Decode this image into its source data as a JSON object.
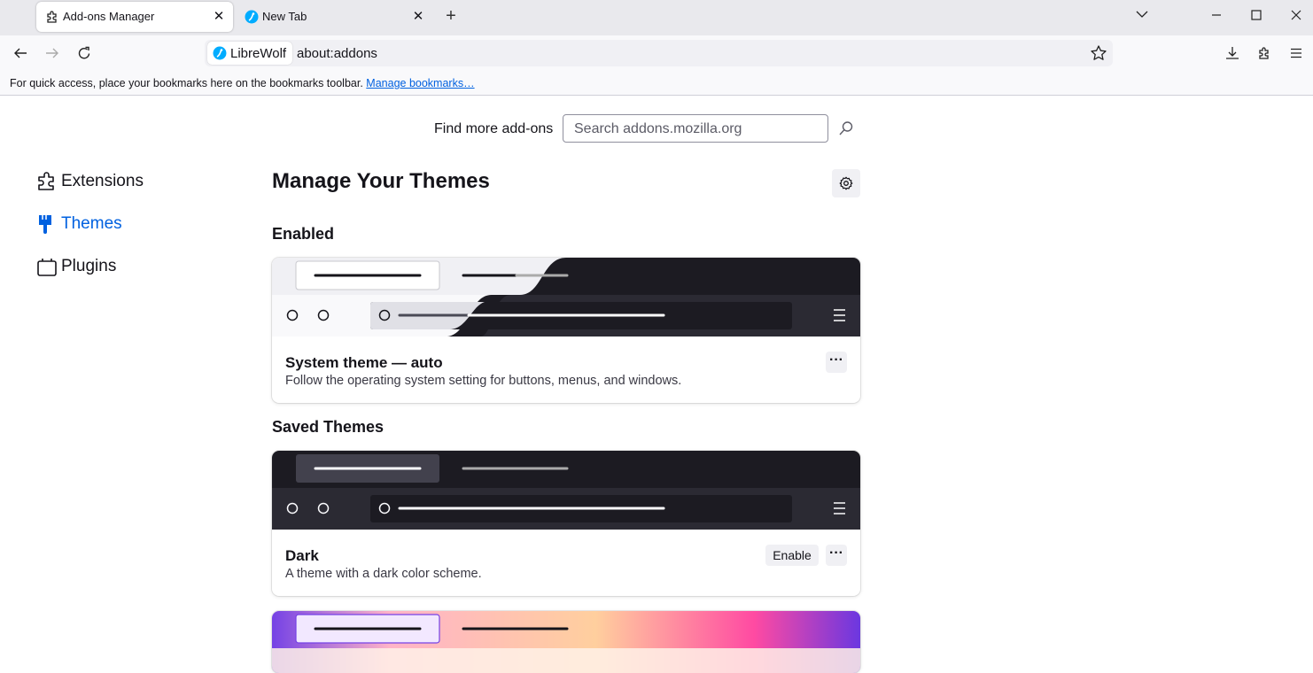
{
  "browser": {
    "tabs": [
      {
        "label": "Add-ons Manager",
        "active": true,
        "icon": "puzzle-icon"
      },
      {
        "label": "New Tab",
        "active": false,
        "icon": "librewolf-icon"
      }
    ],
    "new_tab_symbol": "+",
    "close_symbol": "✕",
    "urlbar": {
      "identity_label": "LibreWolf",
      "url": "about:addons"
    },
    "bookmarks_toolbar": {
      "message": "For quick access, place your bookmarks here on the bookmarks toolbar.",
      "link": "Manage bookmarks…"
    }
  },
  "addons": {
    "find_more_label": "Find more add-ons",
    "search_placeholder": "Search addons.mozilla.org",
    "categories": [
      {
        "label": "Extensions",
        "icon": "puzzle-icon",
        "selected": false
      },
      {
        "label": "Themes",
        "icon": "paintbrush-icon",
        "selected": true
      },
      {
        "label": "Plugins",
        "icon": "plugin-icon",
        "selected": false
      }
    ],
    "heading": "Manage Your Themes",
    "enabled_heading": "Enabled",
    "saved_heading": "Saved Themes",
    "themes": [
      {
        "name": "System theme — auto",
        "description": "Follow the operating system setting for buttons, menus, and windows."
      },
      {
        "name": "Dark",
        "description": "A theme with a dark color scheme.",
        "enable_label": "Enable"
      }
    ],
    "more_symbol": "···"
  },
  "colors": {
    "accent": "#0061e0",
    "dark_preview": "#1c1b22",
    "light_preview": "#f0f0f4"
  }
}
